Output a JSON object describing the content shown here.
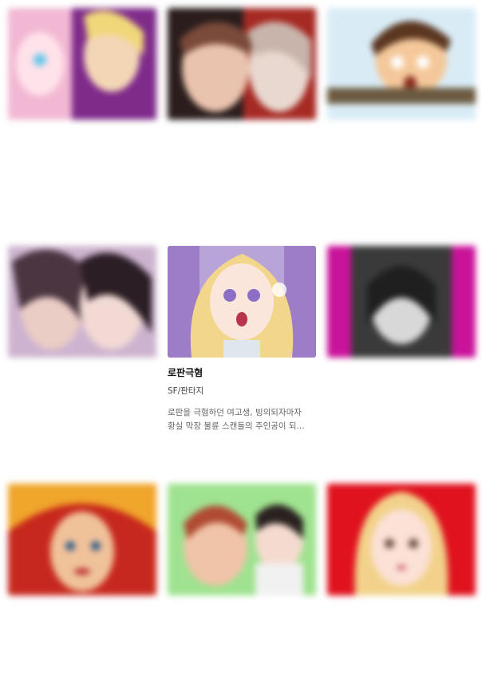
{
  "cards": [
    {
      "title": "",
      "genre": "",
      "desc_1": "",
      "desc_2": "",
      "blurred": true,
      "bg": "#f2b8d3",
      "accent": "#8c2f8f"
    },
    {
      "title": "",
      "genre": "",
      "desc_1": "",
      "desc_2": "",
      "blurred": true,
      "bg": "#9b3a2c",
      "accent": "#c9a08a"
    },
    {
      "title": "",
      "genre": "",
      "desc_1": "",
      "desc_2": "",
      "blurred": true,
      "bg": "#d9e7f4",
      "accent": "#7a4a1e"
    },
    {
      "title": "",
      "genre": "",
      "desc_1": "",
      "desc_2": "",
      "blurred": true,
      "bg": "#c9a7c9",
      "accent": "#3c2a35"
    },
    {
      "title": "로판극혐",
      "genre": "SF/판타지",
      "desc_1": "로판을 극혐하던 여고생, 빙의되자마자",
      "desc_2": "황실 막장 불륜 스캔들의 주인공이 되...",
      "blurred": false,
      "bg": "#b9a4d8",
      "accent": "#f1d68c"
    },
    {
      "title": "",
      "genre": "",
      "desc_1": "",
      "desc_2": "",
      "blurred": true,
      "bg": "#c9139a",
      "accent": "#3a3a3a"
    },
    {
      "title": "",
      "genre": "",
      "desc_1": "",
      "desc_2": "",
      "blurred": true,
      "bg": "#c7281d",
      "accent": "#f0c29a"
    },
    {
      "title": "",
      "genre": "",
      "desc_1": "",
      "desc_2": "",
      "blurred": true,
      "bg": "#9fe28f",
      "accent": "#b14a33"
    },
    {
      "title": "",
      "genre": "",
      "desc_1": "",
      "desc_2": "",
      "blurred": true,
      "bg": "#e0121e",
      "accent": "#f2d28a"
    }
  ]
}
